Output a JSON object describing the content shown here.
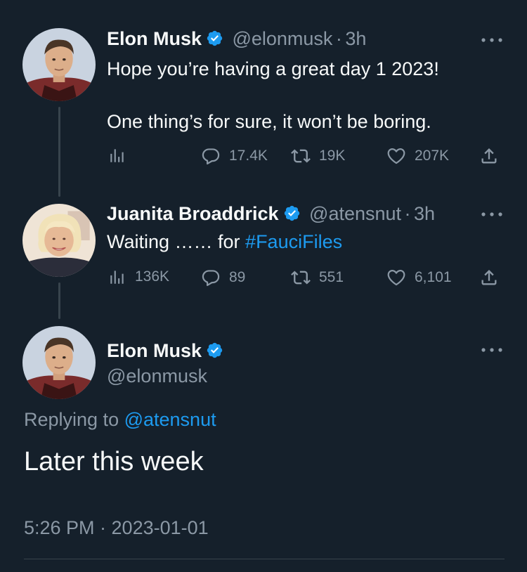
{
  "colors": {
    "background": "#15202b",
    "text": "#f7f9f9",
    "muted": "#8b98a5",
    "link": "#1d9bf0",
    "verified": "#1d9bf0",
    "thread_line": "#38444d"
  },
  "tweet1": {
    "name": "Elon Musk",
    "handle": "@elonmusk",
    "sep": "·",
    "time": "3h",
    "line1": "Hope you’re having a great day 1 2023!",
    "line2": "One thing’s for sure, it won’t be boring.",
    "replies": "17.4K",
    "retweets": "19K",
    "likes": "207K",
    "icons": [
      "analytics-icon",
      "reply-icon",
      "retweet-icon",
      "like-icon",
      "share-icon",
      "more-icon",
      "verified-icon"
    ]
  },
  "tweet2": {
    "name": "Juanita Broaddrick",
    "handle": "@atensnut",
    "sep": "·",
    "time": "3h",
    "text_prefix": "Waiting …… for ",
    "hashtag": "#FauciFiles",
    "views": "136K",
    "replies": "89",
    "retweets": "551",
    "likes": "6,101"
  },
  "main_tweet": {
    "name": "Elon Musk",
    "handle": "@elonmusk",
    "replying_prefix": "Replying to ",
    "replying_handle": "@atensnut",
    "text": "Later this week",
    "timestamp": "5:26 PM · 2023-01-01"
  }
}
